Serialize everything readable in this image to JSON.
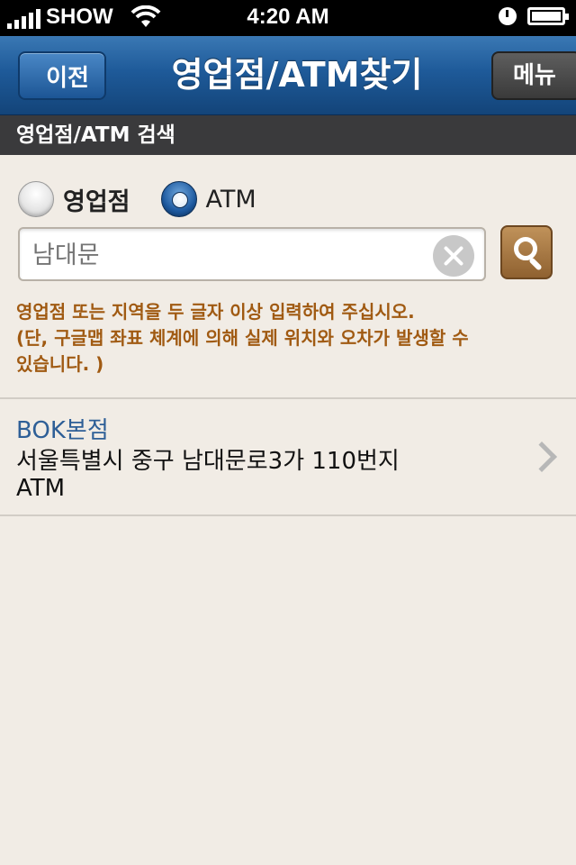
{
  "status_bar": {
    "carrier": "SHOW",
    "time": "4:20 AM"
  },
  "nav": {
    "back_label": "이전",
    "title": "영업점/ATM찾기",
    "menu_label": "메뉴"
  },
  "section": {
    "title": "영업점/ATM 검색"
  },
  "search_type": {
    "options": [
      {
        "label": "영업점",
        "selected": false
      },
      {
        "label": "ATM",
        "selected": true
      }
    ]
  },
  "search": {
    "value": "",
    "placeholder": "남대문"
  },
  "notice": {
    "line1": "영업점 또는 지역을 두 글자 이상 입력하여 주십시오.",
    "line2": "(단, 구글맵 좌표 체계에 의해 실제 위치와 오차가 발생할 수",
    "line3": "있습니다. )"
  },
  "results": [
    {
      "name": "BOK본점",
      "address": "서울특별시 중구 남대문로3가 110번지",
      "type": "ATM"
    }
  ],
  "colors": {
    "nav_blue": "#1e5a99",
    "section_dark": "#3a3a3c",
    "notice_brown": "#a05a12",
    "result_name_blue": "#2e5f97",
    "background": "#f1ece5"
  }
}
